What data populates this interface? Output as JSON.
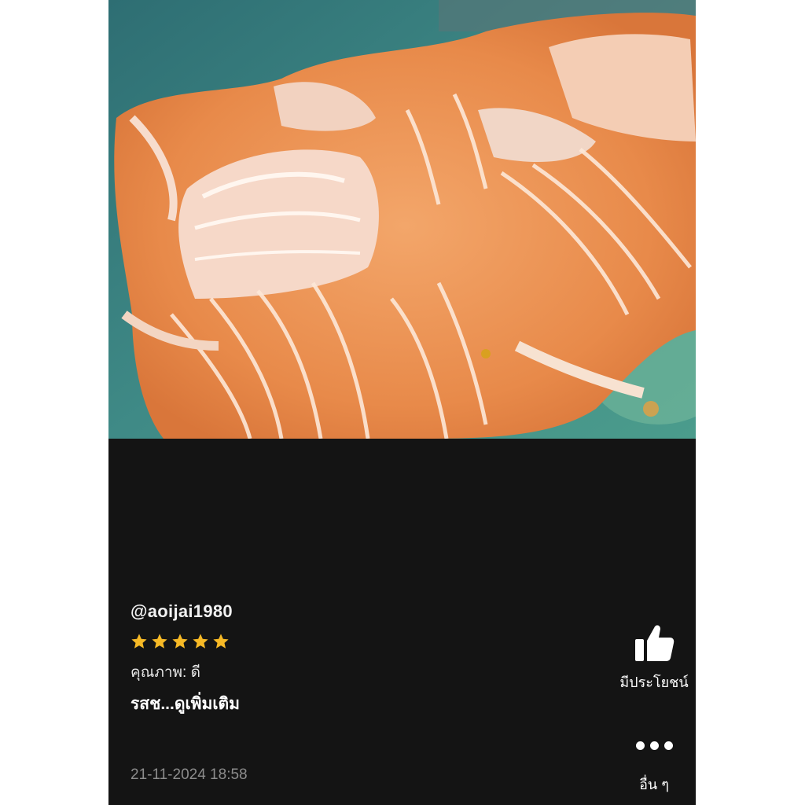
{
  "photo": {
    "icon": "food-photo-salmon"
  },
  "review": {
    "username": "@aoijai1980",
    "rating": 5,
    "rating_max": 5,
    "quality_line": "คุณภาพ: ดี",
    "taste_line": "รสช...ดูเพิ่มเติม",
    "timestamp": "21-11-2024 18:58"
  },
  "actions": {
    "helpful_label": "มีประโยชน์",
    "helpful_icon": "thumbs-up-icon",
    "more_label": "อื่น ๆ",
    "more_icon": "more-dots-icon"
  },
  "colors": {
    "background": "#141414",
    "star": "#f6b926",
    "text_primary": "#ffffff",
    "text_muted": "#8c8c8c"
  }
}
